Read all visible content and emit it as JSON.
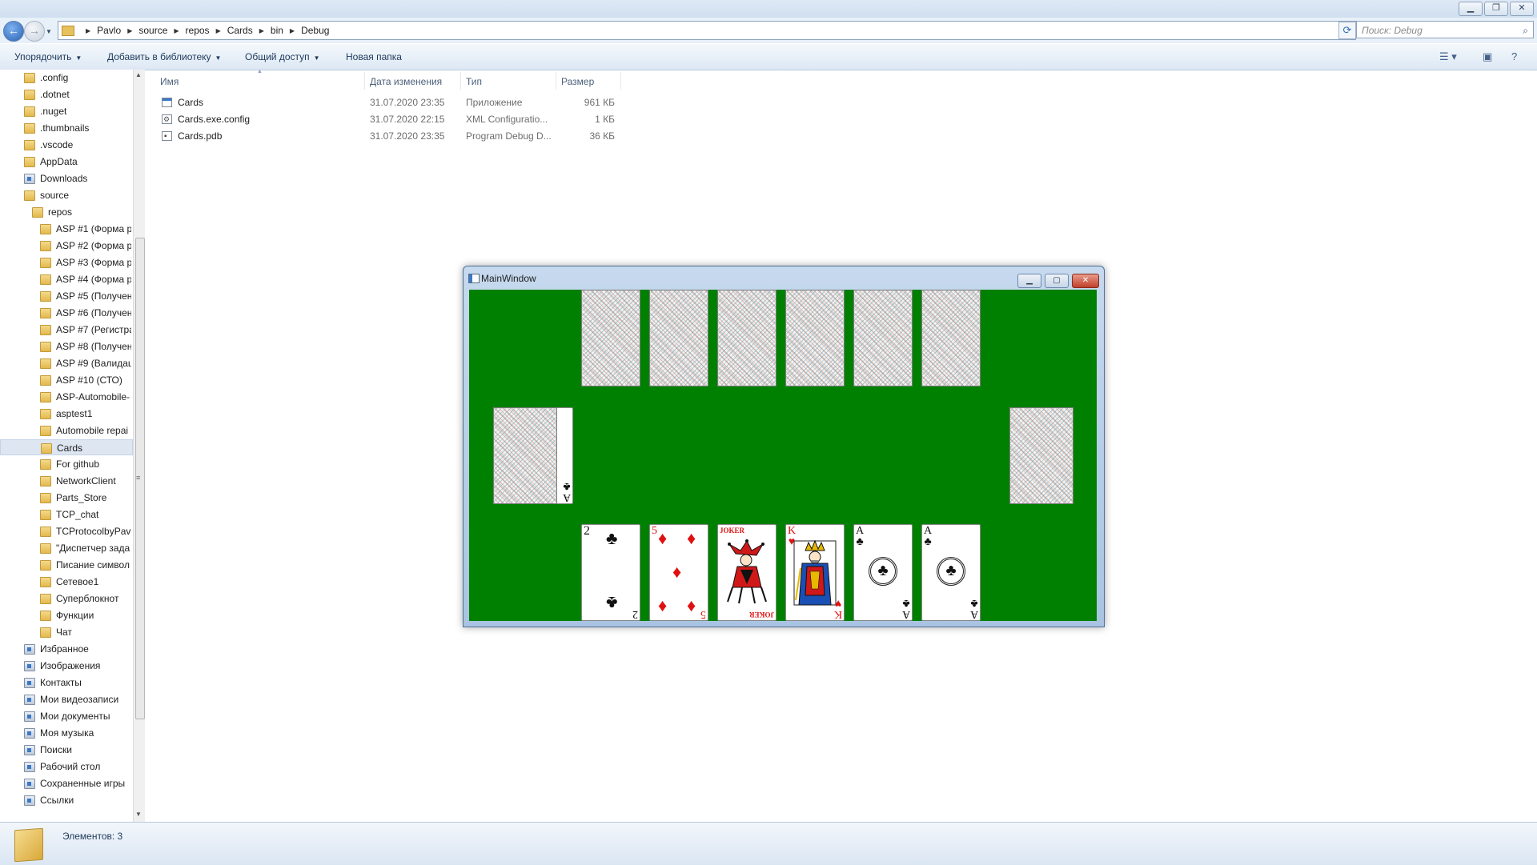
{
  "explorer": {
    "breadcrumb": [
      "Pavlo",
      "source",
      "repos",
      "Cards",
      "bin",
      "Debug"
    ],
    "search_placeholder": "Поиск: Debug",
    "toolbar": {
      "organize": "Упорядочить",
      "add_to_library": "Добавить в библиотеку",
      "share": "Общий доступ",
      "new_folder": "Новая папка"
    },
    "nav_tree": [
      {
        "label": ".config",
        "indent": 1,
        "type": "folder"
      },
      {
        "label": ".dotnet",
        "indent": 1,
        "type": "folder"
      },
      {
        "label": ".nuget",
        "indent": 1,
        "type": "folder"
      },
      {
        "label": ".thumbnails",
        "indent": 1,
        "type": "folder"
      },
      {
        "label": ".vscode",
        "indent": 1,
        "type": "folder"
      },
      {
        "label": "AppData",
        "indent": 1,
        "type": "folder"
      },
      {
        "label": "Downloads",
        "indent": 1,
        "type": "special"
      },
      {
        "label": "source",
        "indent": 1,
        "type": "folder"
      },
      {
        "label": "repos",
        "indent": 2,
        "type": "folder"
      },
      {
        "label": "ASP #1 (Форма р",
        "indent": 3,
        "type": "folder"
      },
      {
        "label": "ASP #2 (Форма р",
        "indent": 3,
        "type": "folder"
      },
      {
        "label": "ASP #3 (Форма р",
        "indent": 3,
        "type": "folder"
      },
      {
        "label": "ASP #4 (Форма р",
        "indent": 3,
        "type": "folder"
      },
      {
        "label": "ASP #5 (Получен",
        "indent": 3,
        "type": "folder"
      },
      {
        "label": "ASP #6 (Получен",
        "indent": 3,
        "type": "folder"
      },
      {
        "label": "ASP #7 (Регистра",
        "indent": 3,
        "type": "folder"
      },
      {
        "label": "ASP #8 (Получен",
        "indent": 3,
        "type": "folder"
      },
      {
        "label": "ASP #9 (Валидац",
        "indent": 3,
        "type": "folder"
      },
      {
        "label": "ASP #10 (СТО)",
        "indent": 3,
        "type": "folder"
      },
      {
        "label": "ASP-Automobile-",
        "indent": 3,
        "type": "folder"
      },
      {
        "label": "asptest1",
        "indent": 3,
        "type": "folder"
      },
      {
        "label": "Automobile repai",
        "indent": 3,
        "type": "folder"
      },
      {
        "label": "Cards",
        "indent": 3,
        "type": "folder",
        "selected": true
      },
      {
        "label": "For github",
        "indent": 3,
        "type": "folder"
      },
      {
        "label": "NetworkClient",
        "indent": 3,
        "type": "folder"
      },
      {
        "label": "Parts_Store",
        "indent": 3,
        "type": "folder"
      },
      {
        "label": "TCP_chat",
        "indent": 3,
        "type": "folder"
      },
      {
        "label": "TCProtocolbyPav",
        "indent": 3,
        "type": "folder"
      },
      {
        "label": "\"Диспетчер зада",
        "indent": 3,
        "type": "folder"
      },
      {
        "label": "Писание символ",
        "indent": 3,
        "type": "folder"
      },
      {
        "label": "Сетевое1",
        "indent": 3,
        "type": "folder"
      },
      {
        "label": "Суперблокнот",
        "indent": 3,
        "type": "folder"
      },
      {
        "label": "Функции",
        "indent": 3,
        "type": "folder"
      },
      {
        "label": "Чат",
        "indent": 3,
        "type": "folder"
      },
      {
        "label": "Избранное",
        "indent": 1,
        "type": "special"
      },
      {
        "label": "Изображения",
        "indent": 1,
        "type": "special"
      },
      {
        "label": "Контакты",
        "indent": 1,
        "type": "special"
      },
      {
        "label": "Мои видеозаписи",
        "indent": 1,
        "type": "special"
      },
      {
        "label": "Мои документы",
        "indent": 1,
        "type": "special"
      },
      {
        "label": "Моя музыка",
        "indent": 1,
        "type": "special"
      },
      {
        "label": "Поиски",
        "indent": 1,
        "type": "special"
      },
      {
        "label": "Рабочий стол",
        "indent": 1,
        "type": "special"
      },
      {
        "label": "Сохраненные игры",
        "indent": 1,
        "type": "special"
      },
      {
        "label": "Ссылки",
        "indent": 1,
        "type": "special"
      }
    ],
    "columns": {
      "name": "Имя",
      "date": "Дата изменения",
      "type": "Тип",
      "size": "Размер"
    },
    "files": [
      {
        "name": "Cards",
        "date": "31.07.2020 23:35",
        "type": "Приложение",
        "size": "961 КБ",
        "icon": "app-icon"
      },
      {
        "name": "Cards.exe.config",
        "date": "31.07.2020 22:15",
        "type": "XML Configuratio...",
        "size": "1 КБ",
        "icon": "config-file-icon"
      },
      {
        "name": "Cards.pdb",
        "date": "31.07.2020 23:35",
        "type": "Program Debug D...",
        "size": "36 КБ",
        "icon": "pdb-file-icon"
      }
    ],
    "status": "Элементов: 3"
  },
  "main_window": {
    "title": "MainWindow",
    "felt_color": "#008000",
    "top_row": [
      "card-back",
      "card-back",
      "card-back",
      "card-back",
      "card-back",
      "card-back"
    ],
    "deck_left": {
      "face": "card-back",
      "peek_rank": "A",
      "peek_suit": "♣"
    },
    "deck_right": "card-back",
    "hand": [
      {
        "rank": "2",
        "suit": "♣",
        "color": "black"
      },
      {
        "rank": "5",
        "suit": "♦",
        "color": "red"
      },
      {
        "rank": "JOKER",
        "suit": "",
        "color": "red"
      },
      {
        "rank": "K",
        "suit": "♥",
        "color": "red"
      },
      {
        "rank": "A",
        "suit": "♣",
        "color": "black"
      },
      {
        "rank": "A",
        "suit": "♣",
        "color": "black"
      }
    ]
  }
}
